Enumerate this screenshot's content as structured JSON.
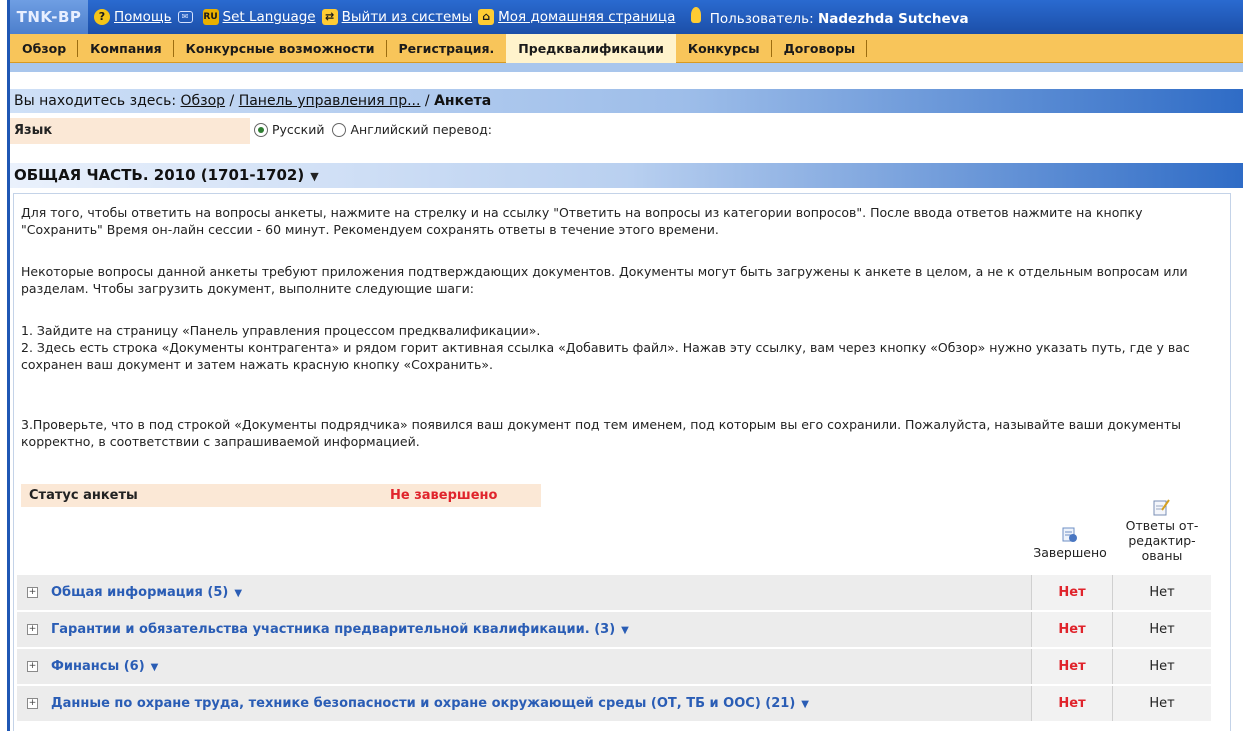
{
  "header": {
    "logo": "TNK-BP",
    "help": "Помощь",
    "set_language": "Set Language",
    "logout": "Выйти из системы",
    "home": "Моя домашняя страница",
    "user_label": "Пользователь:",
    "user_name": "Nadezhda Sutcheva"
  },
  "nav": {
    "tabs": [
      {
        "label": "Обзор"
      },
      {
        "label": "Компания"
      },
      {
        "label": "Конкурсные возможности"
      },
      {
        "label": "Регистрация."
      },
      {
        "label": "Предквалификации"
      },
      {
        "label": "Конкурсы"
      },
      {
        "label": "Договоры"
      }
    ]
  },
  "breadcrumb": {
    "prefix": "Вы находитесь здесь:",
    "link1": "Обзор",
    "sep": "/",
    "link2": "Панель управления пр...",
    "current": "Анкета"
  },
  "language": {
    "label": "Язык",
    "option_ru": "Русский",
    "option_en": "Английский перевод:",
    "selected": "Русский"
  },
  "section": {
    "title": "ОБЩАЯ ЧАСТЬ. 2010 (1701-1702)"
  },
  "instructions": {
    "p1": "Для того, чтобы ответить на вопросы анкеты, нажмите на стрелку и на ссылку \"Ответить на вопросы из категории вопросов\". После ввода ответов нажмите на кнопку \"Сохранить\" Время он-лайн сессии - 60 минут. Рекомендуем сохранять ответы в течение этого времени.",
    "p2": "Некоторые вопросы данной анкеты требуют приложения подтверждающих документов. Документы могут быть загружены к анкете в целом, а не к отдельным вопросам или разделам. Чтобы загрузить документ, выполните следующие шаги:",
    "p3a": "1. Зайдите на страницу «Панель управления процессом предквалификации».",
    "p3b": "2. Здесь есть строка «Документы контрагента» и рядом горит активная ссылка «Добавить файл». Нажав эту ссылку, вам через кнопку «Обзор» нужно указать путь, где у вас сохранен ваш документ и затем нажать красную кнопку «Сохранить».",
    "p4": "3.Проверьте, что в под строкой «Документы подрядчика» появился ваш документ под тем именем, под которым вы его сохранили. Пожалуйста, называйте ваши документы корректно, в соответствии с запрашиваемой информацией."
  },
  "status": {
    "label": "Статус анкеты",
    "value": "Не завершено"
  },
  "columns": {
    "completed": "Завершено",
    "edited_line1": "Ответы от-",
    "edited_line2": "редактир-",
    "edited_line3": "ованы"
  },
  "categories": [
    {
      "title": "Общая информация (5)",
      "completed": "Нет",
      "edited": "Нет"
    },
    {
      "title": "Гарантии и обязательства участника предварительной квалификации. (3)",
      "completed": "Нет",
      "edited": "Нет"
    },
    {
      "title": "Финансы (6)",
      "completed": "Нет",
      "edited": "Нет"
    },
    {
      "title": "Данные по охране труда, технике безопасности и охране окружающей среды (ОТ, ТБ и ООС) (21)",
      "completed": "Нет",
      "edited": "Нет"
    }
  ],
  "colors": {
    "header_blue": "#1c4fa8",
    "nav_orange": "#f8c55a",
    "status_red": "#e0242c",
    "link_blue": "#2a5db5"
  }
}
